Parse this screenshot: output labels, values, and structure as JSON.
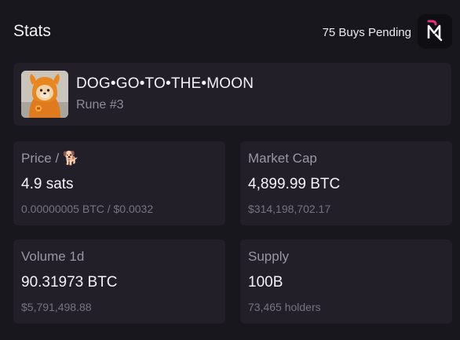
{
  "header": {
    "title": "Stats",
    "pending_label": "75 Buys Pending"
  },
  "rune": {
    "name": "DOG•GO•TO•THE•MOON",
    "number": "Rune #3",
    "image_icon": "dog-in-orange-hoodie-image"
  },
  "stats": {
    "price": {
      "label": "Price / 🐕",
      "value": "4.9 sats",
      "sub": "0.00000005 BTC / $0.0032"
    },
    "market_cap": {
      "label": "Market Cap",
      "value": "4,899.99 BTC",
      "sub": "$314,198,702.17"
    },
    "volume": {
      "label": "Volume 1d",
      "value": "90.31973 BTC",
      "sub": "$5,791,498.88"
    },
    "supply": {
      "label": "Supply",
      "value": "100B",
      "sub": "73,465 holders"
    }
  },
  "colors": {
    "background": "#19171e",
    "card": "#221f29",
    "logo_accent": "#e0337a"
  }
}
